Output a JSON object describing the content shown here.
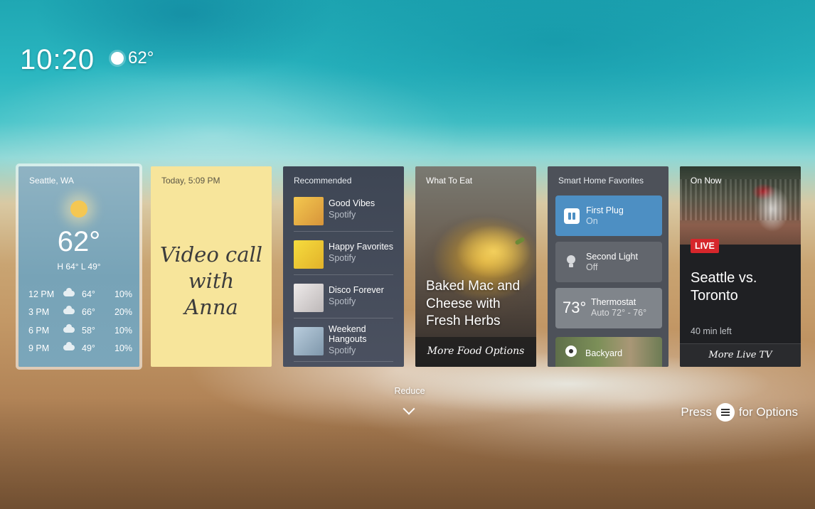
{
  "status": {
    "time": "10:20",
    "current_temp": "62°"
  },
  "cards": {
    "weather": {
      "location": "Seattle, WA",
      "temp": "62°",
      "hilo": "H 64°  L 49°",
      "forecast": [
        {
          "time": "12 PM",
          "temp": "64°",
          "precip": "10%"
        },
        {
          "time": "3 PM",
          "temp": "66°",
          "precip": "20%"
        },
        {
          "time": "6 PM",
          "temp": "58°",
          "precip": "10%"
        },
        {
          "time": "9 PM",
          "temp": "49°",
          "precip": "10%"
        }
      ]
    },
    "note": {
      "header": "Today, 5:09 PM",
      "line1": "Video call",
      "line2": "with",
      "line3": "Anna"
    },
    "recommended": {
      "title": "Recommended",
      "items": [
        {
          "name": "Good Vibes",
          "service": "Spotify",
          "color": "#e8b64a"
        },
        {
          "name": "Happy Favorites",
          "service": "Spotify",
          "color": "#f2d43c"
        },
        {
          "name": "Disco Forever",
          "service": "Spotify",
          "color": "#d9d6d6"
        },
        {
          "name": "Weekend Hangouts",
          "service": "Spotify",
          "color": "#9fb6c9"
        }
      ]
    },
    "food": {
      "title": "What To Eat",
      "headline": "Baked Mac and Cheese with Fresh Herbs",
      "more": "More Food Options"
    },
    "smarthome": {
      "title": "Smart Home Favorites",
      "plug": {
        "name": "First Plug",
        "state": "On"
      },
      "light": {
        "name": "Second Light",
        "state": "Off"
      },
      "thermostat": {
        "temp": "73°",
        "name": "Thermostat",
        "mode": "Auto 72° - 76°"
      },
      "camera": {
        "name": "Backyard"
      }
    },
    "onnow": {
      "title": "On Now",
      "badge": "LIVE",
      "headline": "Seattle vs. Toronto",
      "remaining": "40 min left",
      "more": "More Live TV"
    }
  },
  "footer": {
    "reduce": "Reduce",
    "press": "Press",
    "for_options": "for Options"
  }
}
